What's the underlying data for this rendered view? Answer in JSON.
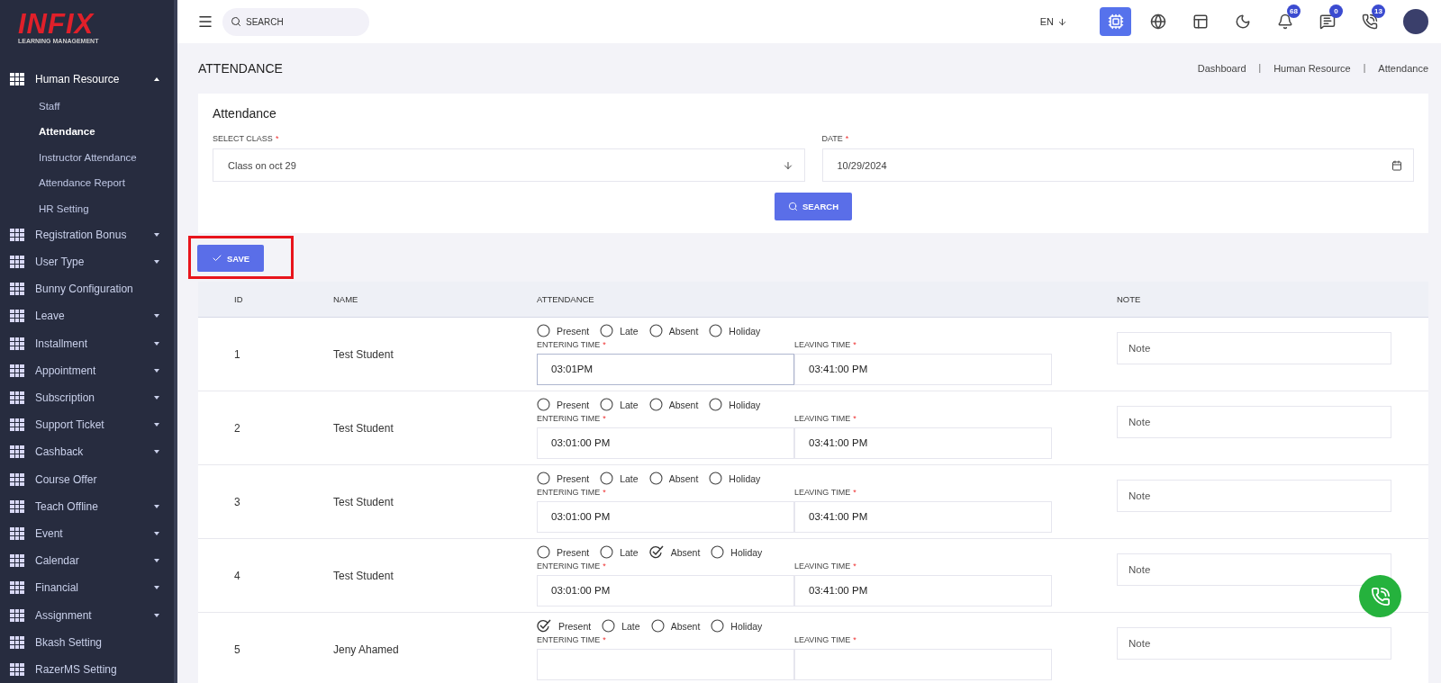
{
  "logo": {
    "brand": "INFIX",
    "tagline": "LEARNING MANAGEMENT"
  },
  "sidebar": {
    "items": [
      {
        "label": "Human Resource",
        "expanded": true,
        "children": [
          {
            "label": "Staff",
            "selected": false
          },
          {
            "label": "Attendance",
            "selected": true
          },
          {
            "label": "Instructor Attendance",
            "selected": false
          },
          {
            "label": "Attendance Report",
            "selected": false
          },
          {
            "label": "HR Setting",
            "selected": false
          }
        ]
      },
      {
        "label": "Registration Bonus",
        "expanded": false
      },
      {
        "label": "User Type",
        "expanded": false
      },
      {
        "label": "Bunny Configuration"
      },
      {
        "label": "Leave",
        "expanded": false
      },
      {
        "label": "Installment",
        "expanded": false
      },
      {
        "label": "Appointment",
        "expanded": false
      },
      {
        "label": "Subscription",
        "expanded": false
      },
      {
        "label": "Support Ticket",
        "expanded": false
      },
      {
        "label": "Cashback",
        "expanded": false
      },
      {
        "label": "Course Offer"
      },
      {
        "label": "Teach Offline",
        "expanded": false
      },
      {
        "label": "Event",
        "expanded": false
      },
      {
        "label": "Calendar",
        "expanded": false
      },
      {
        "label": "Financial",
        "expanded": false
      },
      {
        "label": "Assignment",
        "expanded": false
      },
      {
        "label": "Bkash Setting"
      },
      {
        "label": "RazerMS Setting"
      }
    ]
  },
  "topbar": {
    "search": {
      "placeholder": "SEARCH"
    },
    "language": "EN",
    "ai_active": true,
    "badges": [
      {
        "kind": "bell",
        "count": "68"
      },
      {
        "kind": "chat",
        "count": "0"
      },
      {
        "kind": "phone",
        "count": "13"
      }
    ]
  },
  "page": {
    "title": "ATTENDANCE",
    "breadcrumb": [
      {
        "kind": "link",
        "text": "Dashboard"
      },
      {
        "kind": "separator",
        "text": "|"
      },
      {
        "kind": "link",
        "text": "Human Resource"
      },
      {
        "kind": "separator",
        "text": "|"
      },
      {
        "kind": "link",
        "text": "Attendance"
      }
    ]
  },
  "filter": {
    "title": "Attendance",
    "class_label": {
      "text": "SELECT CLASS",
      "mark": "*"
    },
    "class_value": "Class on oct 29",
    "date_label": {
      "text": "DATE",
      "mark": "*"
    },
    "date_value": "10/29/2024",
    "search_label": "SEARCH"
  },
  "save_button": {
    "label": "SAVE",
    "highlighted": true
  },
  "table": {
    "columns": [
      "ID",
      "NAME",
      "ATTENDANCE",
      "NOTE"
    ],
    "rows": [
      {
        "id": "1",
        "name": "Test Student",
        "options": [
          {
            "label": "Present",
            "selected": false
          },
          {
            "label": "Late",
            "selected": false
          },
          {
            "label": "Absent",
            "selected": false
          },
          {
            "label": "Holiday",
            "selected": false
          }
        ],
        "entering_label": {
          "text": "ENTERING TIME",
          "mark": "*"
        },
        "entering": "03:01PM",
        "entering_focused": true,
        "leaving_label": {
          "text": "LEAVING TIME",
          "mark": "*"
        },
        "leaving": "03:41:00 PM",
        "note_placeholder": "Note"
      },
      {
        "id": "2",
        "name": "Test Student",
        "options": [
          {
            "label": "Present",
            "selected": false
          },
          {
            "label": "Late",
            "selected": false
          },
          {
            "label": "Absent",
            "selected": false
          },
          {
            "label": "Holiday",
            "selected": false
          }
        ],
        "entering_label": {
          "text": "ENTERING TIME",
          "mark": "*"
        },
        "entering": "03:01:00 PM",
        "entering_focused": false,
        "leaving_label": {
          "text": "LEAVING TIME",
          "mark": "*"
        },
        "leaving": "03:41:00 PM",
        "note_placeholder": "Note"
      },
      {
        "id": "3",
        "name": "Test Student",
        "options": [
          {
            "label": "Present",
            "selected": false
          },
          {
            "label": "Late",
            "selected": false
          },
          {
            "label": "Absent",
            "selected": false
          },
          {
            "label": "Holiday",
            "selected": false
          }
        ],
        "entering_label": {
          "text": "ENTERING TIME",
          "mark": "*"
        },
        "entering": "03:01:00 PM",
        "entering_focused": false,
        "leaving_label": {
          "text": "LEAVING TIME",
          "mark": "*"
        },
        "leaving": "03:41:00 PM",
        "note_placeholder": "Note"
      },
      {
        "id": "4",
        "name": "Test Student",
        "options": [
          {
            "label": "Present",
            "selected": false
          },
          {
            "label": "Late",
            "selected": false
          },
          {
            "label": "Absent",
            "selected": true
          },
          {
            "label": "Holiday",
            "selected": false
          }
        ],
        "entering_label": {
          "text": "ENTERING TIME",
          "mark": "*"
        },
        "entering": "03:01:00 PM",
        "entering_focused": false,
        "leaving_label": {
          "text": "LEAVING TIME",
          "mark": "*"
        },
        "leaving": "03:41:00 PM",
        "note_placeholder": "Note"
      },
      {
        "id": "5",
        "name": "Jeny Ahamed",
        "options": [
          {
            "label": "Present",
            "selected": true
          },
          {
            "label": "Late",
            "selected": false
          },
          {
            "label": "Absent",
            "selected": false
          },
          {
            "label": "Holiday",
            "selected": false
          }
        ],
        "entering_label": {
          "text": "ENTERING TIME",
          "mark": "*"
        },
        "leaving_label": {
          "text": "LEAVING TIME",
          "mark": "*"
        },
        "note_placeholder": "Note"
      }
    ]
  }
}
